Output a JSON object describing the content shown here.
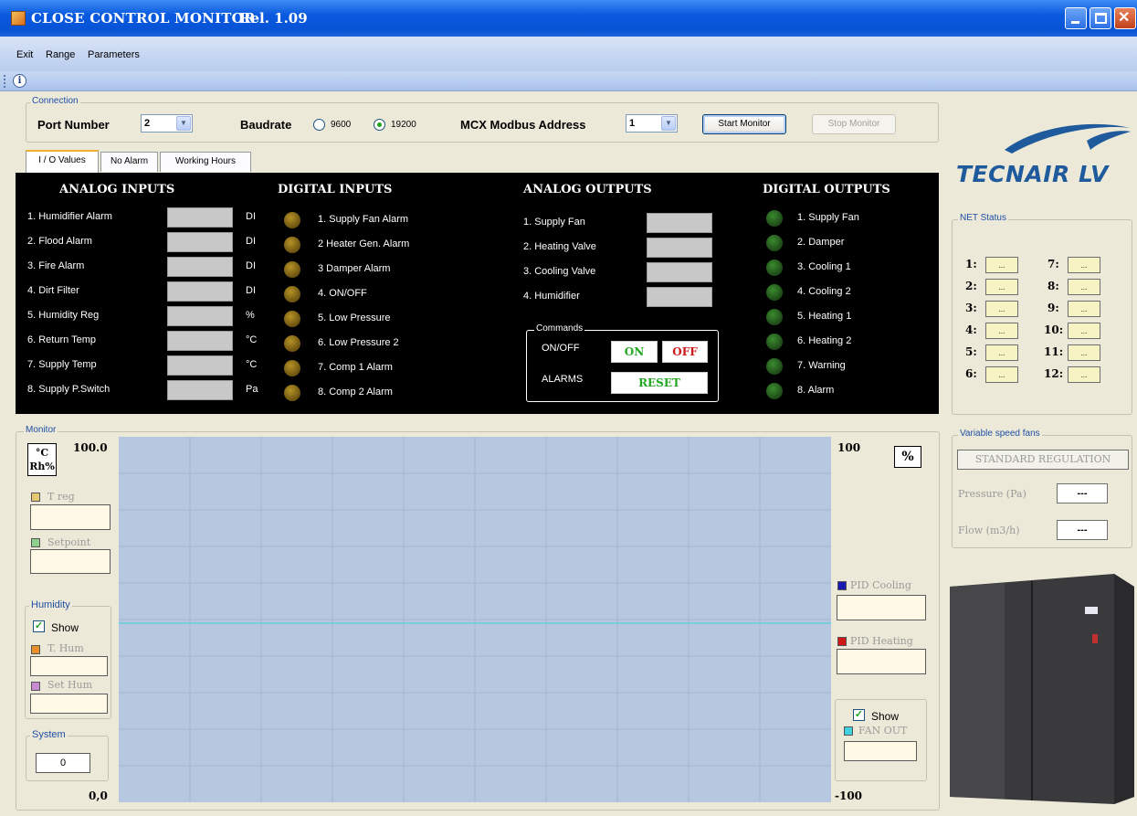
{
  "window": {
    "title": "CLOSE CONTROL MONITOR",
    "release": "Rel. 1.09"
  },
  "menu": [
    "Exit",
    "Range",
    "Parameters"
  ],
  "connection": {
    "caption": "Connection",
    "port_label": "Port Number",
    "port_value": "2",
    "baud_label": "Baudrate",
    "baud_options": [
      "9600",
      "19200"
    ],
    "baud_selected": "19200",
    "modbus_label": "MCX Modbus Address",
    "modbus_value": "1",
    "start_label": "Start Monitor",
    "stop_label": "Stop Monitor"
  },
  "tabs": [
    "I / O Values",
    "No Alarm",
    "Working Hours"
  ],
  "analog_inputs": {
    "title": "ANALOG INPUTS",
    "items": [
      {
        "label": "1. Humidifier Alarm",
        "unit": "DI"
      },
      {
        "label": "2. Flood Alarm",
        "unit": "DI"
      },
      {
        "label": "3. Fire Alarm",
        "unit": "DI"
      },
      {
        "label": "4. Dirt Filter",
        "unit": "DI"
      },
      {
        "label": "5. Humidity Reg",
        "unit": "%"
      },
      {
        "label": "6. Return Temp",
        "unit": "°C"
      },
      {
        "label": "7. Supply Temp",
        "unit": "°C"
      },
      {
        "label": "8. Supply P.Switch",
        "unit": "Pa"
      }
    ]
  },
  "digital_inputs": {
    "title": "DIGITAL INPUTS",
    "items": [
      "1. Supply Fan Alarm",
      "2 Heater Gen. Alarm",
      "3 Damper Alarm",
      "4. ON/OFF",
      "5. Low Pressure",
      "6. Low Pressure 2",
      "7. Comp 1 Alarm",
      "8. Comp 2 Alarm"
    ]
  },
  "analog_outputs": {
    "title": "ANALOG OUTPUTS",
    "items": [
      "1. Supply Fan",
      "2. Heating Valve",
      "3. Cooling Valve",
      "4. Humidifier"
    ]
  },
  "commands": {
    "caption": "Commands",
    "onoff_label": "ON/OFF",
    "on": "ON",
    "off": "OFF",
    "alarms_label": "ALARMS",
    "reset": "RESET"
  },
  "digital_outputs": {
    "title": "DIGITAL OUTPUTS",
    "items": [
      "1. Supply Fan",
      "2. Damper",
      "3. Cooling 1",
      "4. Cooling 2",
      "5. Heating 1",
      "6. Heating 2",
      "7. Warning",
      "8. Alarm"
    ]
  },
  "brand": "TECNAIR LV",
  "net_status": {
    "caption": "NET Status",
    "nodes": [
      {
        "label": "1:",
        "value": "..."
      },
      {
        "label": "2:",
        "value": "..."
      },
      {
        "label": "3:",
        "value": "..."
      },
      {
        "label": "4:",
        "value": "..."
      },
      {
        "label": "5:",
        "value": "..."
      },
      {
        "label": "6:",
        "value": "..."
      },
      {
        "label": "7:",
        "value": "..."
      },
      {
        "label": "8:",
        "value": "..."
      },
      {
        "label": "9:",
        "value": "..."
      },
      {
        "label": "10:",
        "value": "..."
      },
      {
        "label": "11:",
        "value": "..."
      },
      {
        "label": "12:",
        "value": "..."
      }
    ]
  },
  "variable_speed": {
    "caption": "Variable speed fans",
    "mode": "STANDARD REGULATION",
    "pressure_label": "Pressure (Pa)",
    "pressure_value": "---",
    "flow_label": "Flow (m3/h)",
    "flow_value": "---"
  },
  "monitor": {
    "caption": "Monitor",
    "unit_btn": "°C\nRh%",
    "left_max": "100.0",
    "left_min": "0,0",
    "right_max": "100",
    "right_min": "-100",
    "pct_btn": "%",
    "t_reg": "T reg",
    "setpoint": "Setpoint",
    "humidity_caption": "Humidity",
    "show": "Show",
    "t_hum": "T. Hum",
    "set_hum": "Set Hum",
    "system_caption": "System",
    "system_value": "0",
    "pid_cooling": "PID Cooling",
    "pid_heating": "PID Heating",
    "show2": "Show",
    "fan_out": "FAN OUT"
  },
  "colors": {
    "t_reg": "#e6c870",
    "setpoint": "#8fd08f",
    "t_hum": "#e8902a",
    "set_hum": "#c88ad0",
    "pid_cooling": "#1a1ab0",
    "pid_heating": "#d01818",
    "fan_out": "#40d0e0"
  }
}
